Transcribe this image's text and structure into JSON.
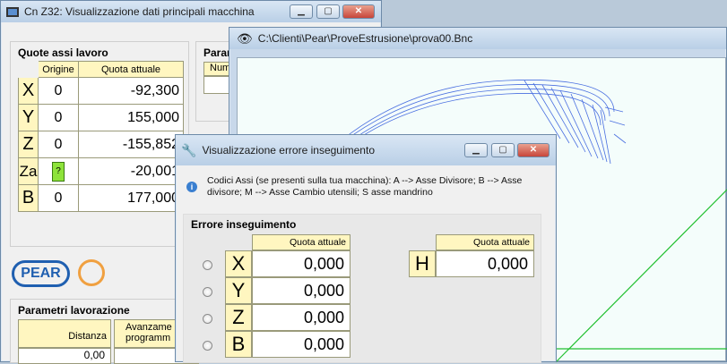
{
  "win1": {
    "title": "Cn Z32: Visualizzazione dati principali macchina",
    "quote": {
      "title": "Quote assi lavoro",
      "col_origine": "Origine",
      "col_quota": "Quota attuale",
      "rows": [
        {
          "axis": "X",
          "origine": "0",
          "quota": "-92,300"
        },
        {
          "axis": "Y",
          "origine": "0",
          "quota": "155,000"
        },
        {
          "axis": "Z",
          "origine": "0",
          "quota": "-155,852"
        },
        {
          "axis": "Za",
          "origine": "?",
          "quota": "-20,001"
        },
        {
          "axis": "B",
          "origine": "0",
          "quota": "177,000"
        }
      ]
    },
    "param_title_partial": "Param",
    "param_col_partial": "Num",
    "logo_text": "PEAR",
    "parametri": {
      "title": "Parametri lavorazione",
      "col_distanza": "Distanza",
      "col_avanz": "Avanzame programm",
      "distanza_value": "0,00"
    }
  },
  "win2": {
    "title": "C:\\Clienti\\Pear\\ProveEstrusione\\prova00.Bnc"
  },
  "win3": {
    "title": "Visualizzazione errore inseguimento",
    "info": "Codici Assi (se presenti sulla tua macchina): A --> Asse Divisore; B --> Asse divisore; M --> Asse Cambio utensili; S asse mandrino",
    "section": "Errore inseguimento",
    "col_quota": "Quota attuale",
    "rows": [
      {
        "axis": "X",
        "value": "0,000"
      },
      {
        "axis": "Y",
        "value": "0,000"
      },
      {
        "axis": "Z",
        "value": "0,000"
      },
      {
        "axis": "B",
        "value": "0,000"
      }
    ],
    "h_axis": "H",
    "h_value": "0,000"
  }
}
